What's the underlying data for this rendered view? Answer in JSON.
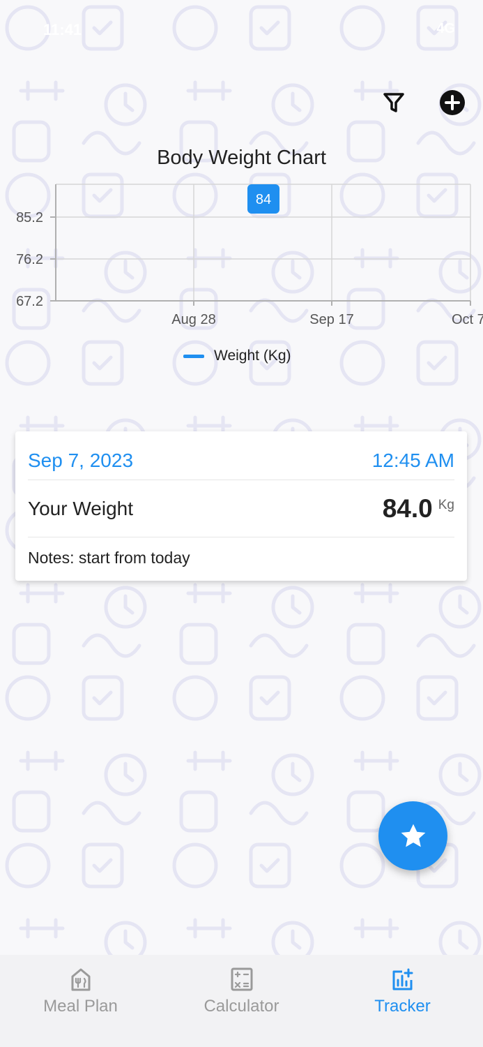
{
  "status_bar": {
    "time": "11:41",
    "right": "4G"
  },
  "header": {
    "filter_icon": "filter-icon",
    "add_icon": "plus-circle-icon"
  },
  "chart_data": {
    "type": "line",
    "title": "Body Weight Chart",
    "x_tick_labels": [
      "Aug 28",
      "Sep 17",
      "Oct 7"
    ],
    "y_tick_labels": [
      "85.2",
      "76.2",
      "67.2"
    ],
    "series": [
      {
        "name": "Weight (Kg)",
        "color": "#1f8ff0",
        "points": [
          {
            "date": "Sep 7, 2023",
            "value": 84
          }
        ]
      }
    ],
    "data_labels": [
      "84"
    ],
    "grid": true,
    "legend": "bottom-center"
  },
  "entry": {
    "date": "Sep 7, 2023",
    "time": "12:45 AM",
    "weight_label": "Your Weight",
    "weight_value": "84.0",
    "weight_unit": "Kg",
    "notes": "Notes: start from today"
  },
  "fab": {
    "icon": "star-icon"
  },
  "bottom_nav": {
    "items": [
      {
        "label": "Meal Plan",
        "icon": "meal-plan-icon",
        "active": false
      },
      {
        "label": "Calculator",
        "icon": "calculator-icon",
        "active": false
      },
      {
        "label": "Tracker",
        "icon": "tracker-icon",
        "active": true
      }
    ]
  },
  "colors": {
    "accent": "#1f8ff0",
    "background": "#f8f8fa",
    "pattern": "#e7e7f4"
  }
}
